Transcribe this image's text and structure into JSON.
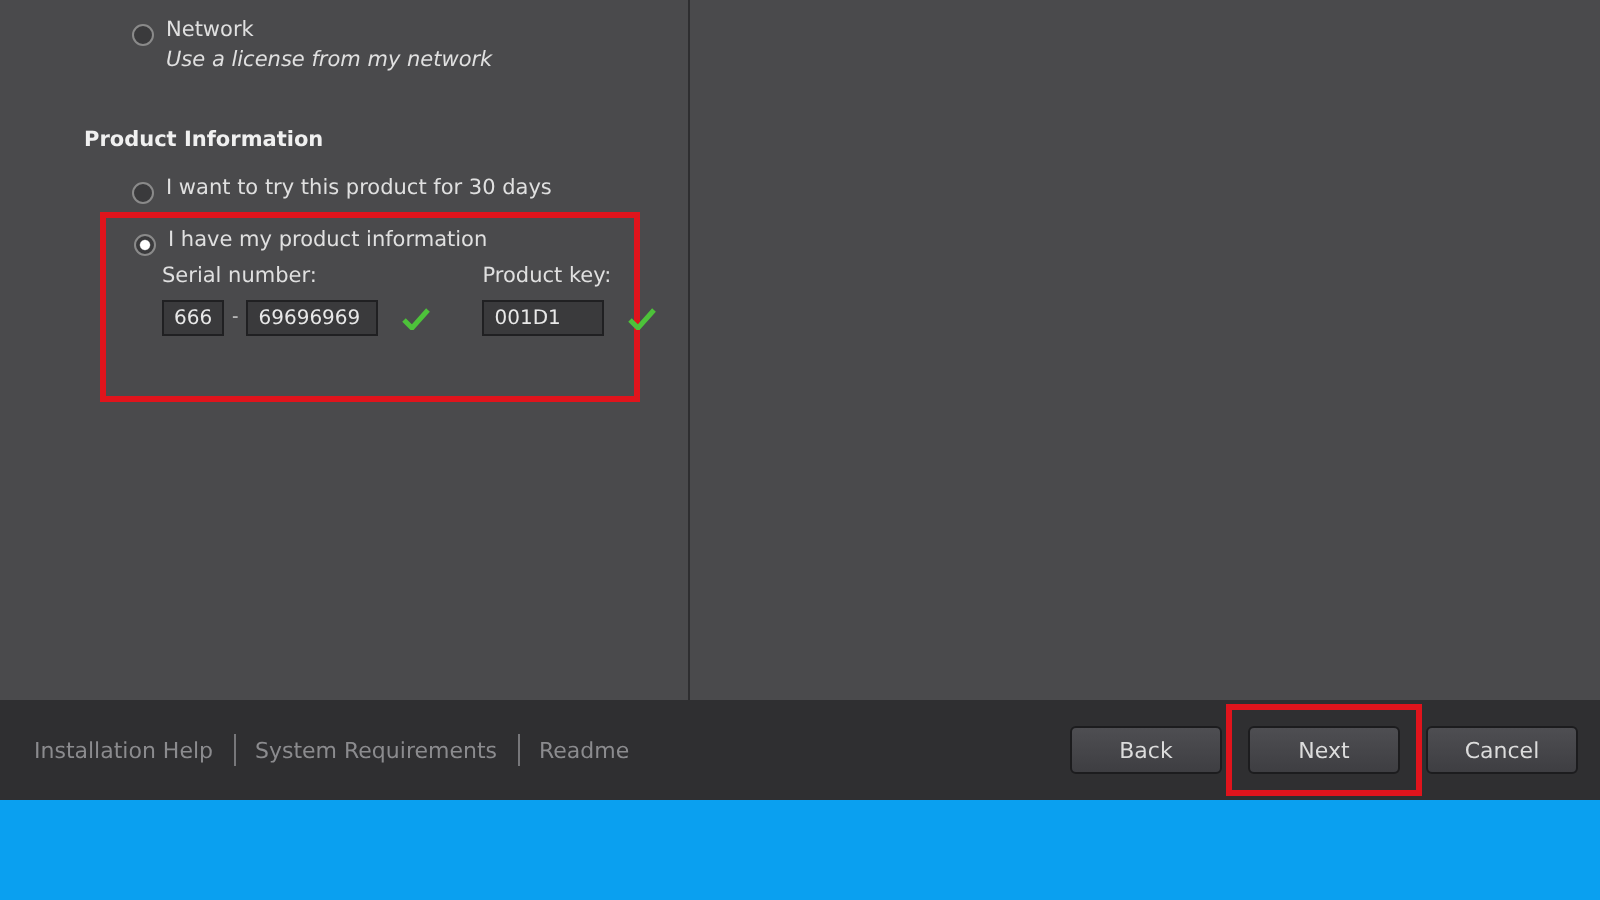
{
  "license_options": [
    {
      "label": "Network",
      "description": "Use a license from my network",
      "selected": false
    }
  ],
  "product_information": {
    "heading": "Product Information",
    "options": [
      {
        "label": "I want to try this product for 30 days",
        "selected": false,
        "highlighted": false
      },
      {
        "label": "I have my product information",
        "selected": true,
        "highlighted": true
      }
    ],
    "serial_number": {
      "label": "Serial number:",
      "prefix": "666",
      "separator": "-",
      "number": "69696969",
      "valid": true
    },
    "product_key": {
      "label": "Product key:",
      "value": "001D1",
      "valid": true
    }
  },
  "footer_links": [
    "Installation Help",
    "System Requirements",
    "Readme"
  ],
  "buttons": [
    {
      "label": "Back",
      "highlighted": false
    },
    {
      "label": "Next",
      "highlighted": true
    },
    {
      "label": "Cancel",
      "highlighted": false
    }
  ]
}
